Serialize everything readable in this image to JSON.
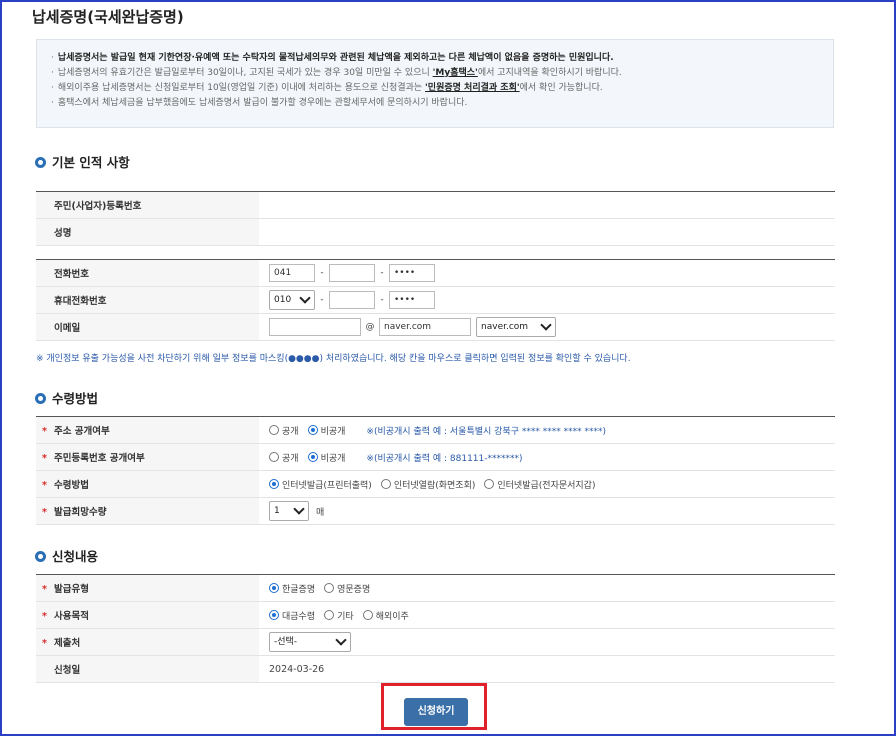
{
  "page_title": "납세증명(국세완납증명)",
  "notice": {
    "line1_bold": "납세증명서는 발급일 현재 기한연장·유예액 또는 수탁자의 물적납세의무와 관련된 체납액을 제외하고는 다른 체납액이 없음을 증명하는 민원입니다.",
    "line2_pre": "납세증명서의 유효기간은 발급일로부터 30일이나, 고지된 국세가 있는 경우 30일 미만일 수 있으니",
    "line2_link": "'My홈택스'",
    "line2_post": "에서 고지내역을 확인하시기 바랍니다.",
    "line3_pre": "해외이주용 납세증명서는 신청일로부터 10일(영업일 기준) 이내에 처리하는 용도으로 신청결과는",
    "line3_link": "'민원증명 처리결과 조회'",
    "line3_post": "에서 확인 가능합니다.",
    "line4": "홈택스에서 체납세금을 납부했음에도 납세증명서 발급이 불가할 경우에는 관할세무서에 문의하시기 바랍니다."
  },
  "section_basic": {
    "title": "기본 인적 사항",
    "rows": {
      "id_label": "주민(사업자)등록번호",
      "name_label": "성명",
      "phone_label": "전화번호",
      "phone1": "041",
      "phone2": "",
      "phone3": "••••",
      "mobile_label": "휴대전화번호",
      "mobile1": "010",
      "mobile2": "",
      "mobile3": "••••",
      "email_label": "이메일",
      "email_id": "",
      "email_at": "@",
      "email_domain": "naver.com",
      "email_select": "naver.com"
    },
    "mask_note": "※ 개인정보 유출 가능성을 사전 차단하기 위해 일부 정보를 마스킹(●●●●) 처리하였습니다. 해당 칸을 마우스로 클릭하면 입력된 정보를 확인할 수 있습니다."
  },
  "section_receive": {
    "title": "수령방법",
    "addr_label": "주소 공개여부",
    "addr_opt1": "공개",
    "addr_opt2": "비공개",
    "addr_example": "※(비공개시 출력 예 : 서울특별시 강북구 **** **** **** ****)",
    "rrn_label": "주민등록번호 공개여부",
    "rrn_opt1": "공개",
    "rrn_opt2": "비공개",
    "rrn_example": "※(비공개시 출력 예 : 881111-*******)",
    "method_label": "수령방법",
    "method_opt1": "인터넷발급(프린터출력)",
    "method_opt2": "인터넷열람(화면조회)",
    "method_opt3": "인터넷발급(전자문서지갑)",
    "qty_label": "발급희망수량",
    "qty_value": "1",
    "qty_unit": "매"
  },
  "section_apply": {
    "title": "신청내용",
    "type_label": "발급유형",
    "type_opt1": "한글증명",
    "type_opt2": "영문증명",
    "purpose_label": "사용목적",
    "purpose_opt1": "대금수령",
    "purpose_opt2": "기타",
    "purpose_opt3": "해외이주",
    "submit_to_label": "제출처",
    "submit_to_value": "-선택-",
    "date_label": "신청일",
    "date_value": "2024-03-26"
  },
  "submit_button": "신청하기",
  "colors": {
    "frame": "#2b3fc2",
    "accent": "#3a6fa8",
    "highlight": "#e0202a",
    "required": "#d52b2b"
  }
}
